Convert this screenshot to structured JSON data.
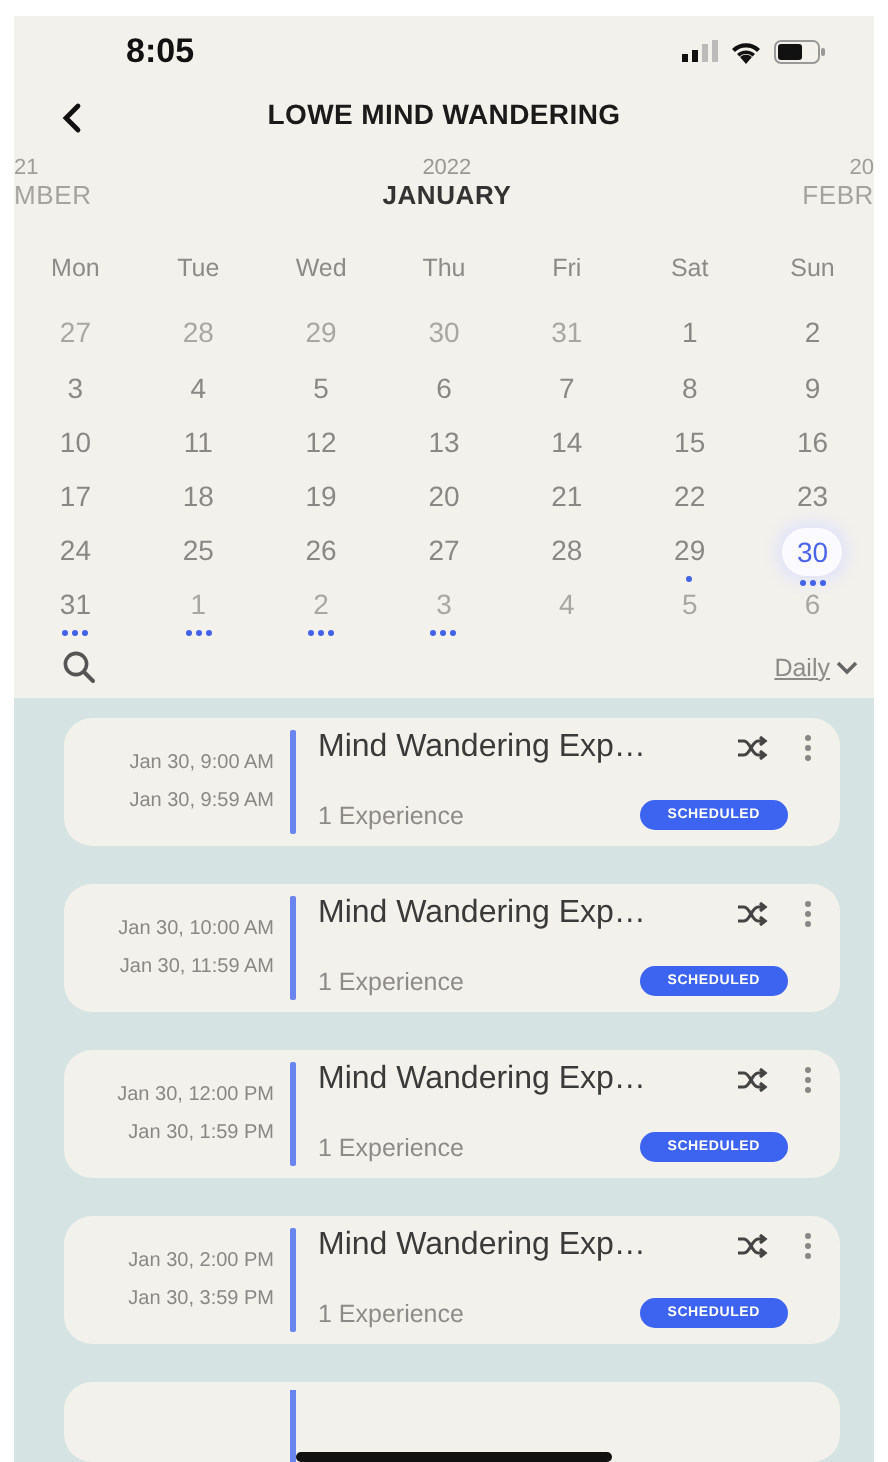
{
  "status_bar": {
    "time": "8:05"
  },
  "nav": {
    "title": "LOWE MIND WANDERING"
  },
  "months": [
    {
      "year": "21",
      "name": "MBER",
      "selected": false
    },
    {
      "year": "2022",
      "name": "JANUARY",
      "selected": true
    },
    {
      "year": "20",
      "name": "FEBR",
      "selected": false
    }
  ],
  "weekdays": [
    "Mon",
    "Tue",
    "Wed",
    "Thu",
    "Fri",
    "Sat",
    "Sun"
  ],
  "weeks": [
    {
      "days": [
        {
          "label": "27",
          "in_month": false,
          "selected": false,
          "has_events": false
        },
        {
          "label": "28",
          "in_month": false,
          "selected": false,
          "has_events": false
        },
        {
          "label": "29",
          "in_month": false,
          "selected": false,
          "has_events": false
        },
        {
          "label": "30",
          "in_month": false,
          "selected": false,
          "has_events": false
        },
        {
          "label": "31",
          "in_month": false,
          "selected": false,
          "has_events": false
        },
        {
          "label": "1",
          "in_month": true,
          "selected": false,
          "has_events": false
        },
        {
          "label": "2",
          "in_month": true,
          "selected": false,
          "has_events": false
        }
      ]
    },
    {
      "days": [
        {
          "label": "3",
          "in_month": true,
          "selected": false,
          "has_events": false
        },
        {
          "label": "4",
          "in_month": true,
          "selected": false,
          "has_events": false
        },
        {
          "label": "5",
          "in_month": true,
          "selected": false,
          "has_events": false
        },
        {
          "label": "6",
          "in_month": true,
          "selected": false,
          "has_events": false
        },
        {
          "label": "7",
          "in_month": true,
          "selected": false,
          "has_events": false
        },
        {
          "label": "8",
          "in_month": true,
          "selected": false,
          "has_events": false
        },
        {
          "label": "9",
          "in_month": true,
          "selected": false,
          "has_events": false
        }
      ]
    },
    {
      "days": [
        {
          "label": "10",
          "in_month": true,
          "selected": false,
          "has_events": false
        },
        {
          "label": "11",
          "in_month": true,
          "selected": false,
          "has_events": false
        },
        {
          "label": "12",
          "in_month": true,
          "selected": false,
          "has_events": false
        },
        {
          "label": "13",
          "in_month": true,
          "selected": false,
          "has_events": false
        },
        {
          "label": "14",
          "in_month": true,
          "selected": false,
          "has_events": false
        },
        {
          "label": "15",
          "in_month": true,
          "selected": false,
          "has_events": false
        },
        {
          "label": "16",
          "in_month": true,
          "selected": false,
          "has_events": false
        }
      ]
    },
    {
      "days": [
        {
          "label": "17",
          "in_month": true,
          "selected": false,
          "has_events": false
        },
        {
          "label": "18",
          "in_month": true,
          "selected": false,
          "has_events": false
        },
        {
          "label": "19",
          "in_month": true,
          "selected": false,
          "has_events": false
        },
        {
          "label": "20",
          "in_month": true,
          "selected": false,
          "has_events": false
        },
        {
          "label": "21",
          "in_month": true,
          "selected": false,
          "has_events": false
        },
        {
          "label": "22",
          "in_month": true,
          "selected": false,
          "has_events": false
        },
        {
          "label": "23",
          "in_month": true,
          "selected": false,
          "has_events": false
        }
      ]
    },
    {
      "days": [
        {
          "label": "24",
          "in_month": true,
          "selected": false,
          "has_events": false
        },
        {
          "label": "25",
          "in_month": true,
          "selected": false,
          "has_events": false
        },
        {
          "label": "26",
          "in_month": true,
          "selected": false,
          "has_events": false
        },
        {
          "label": "27",
          "in_month": true,
          "selected": false,
          "has_events": false
        },
        {
          "label": "28",
          "in_month": true,
          "selected": false,
          "has_events": false
        },
        {
          "label": "29",
          "in_month": true,
          "selected": false,
          "has_events": true,
          "multiple_events": false
        },
        {
          "label": "30",
          "in_month": true,
          "selected": true,
          "has_events": true,
          "multiple_events": true
        }
      ]
    },
    {
      "days": [
        {
          "label": "31",
          "in_month": true,
          "selected": false,
          "has_events": true,
          "multiple_events": true
        },
        {
          "label": "1",
          "in_month": false,
          "selected": false,
          "has_events": true,
          "multiple_events": true
        },
        {
          "label": "2",
          "in_month": false,
          "selected": false,
          "has_events": true,
          "multiple_events": true
        },
        {
          "label": "3",
          "in_month": false,
          "selected": false,
          "has_events": true,
          "multiple_events": true
        },
        {
          "label": "4",
          "in_month": false,
          "selected": false,
          "has_events": false
        },
        {
          "label": "5",
          "in_month": false,
          "selected": false,
          "has_events": false
        },
        {
          "label": "6",
          "in_month": false,
          "selected": false,
          "has_events": false
        }
      ]
    }
  ],
  "view": {
    "label": "Daily"
  },
  "sessions": [
    {
      "start": "Jan 30, 9:00 AM",
      "end": "Jan 30, 9:59 AM",
      "title": "Mind Wandering Exp…",
      "subtitle": "1 Experience",
      "status": "SCHEDULED"
    },
    {
      "start": "Jan 30, 10:00 AM",
      "end": "Jan 30, 11:59 AM",
      "title": "Mind Wandering Exp…",
      "subtitle": "1 Experience",
      "status": "SCHEDULED"
    },
    {
      "start": "Jan 30, 12:00 PM",
      "end": "Jan 30, 1:59 PM",
      "title": "Mind Wandering Exp…",
      "subtitle": "1 Experience",
      "status": "SCHEDULED"
    },
    {
      "start": "Jan 30, 2:00 PM",
      "end": "Jan 30, 3:59 PM",
      "title": "Mind Wandering Exp…",
      "subtitle": "1 Experience",
      "status": "SCHEDULED"
    }
  ],
  "more_below": true
}
